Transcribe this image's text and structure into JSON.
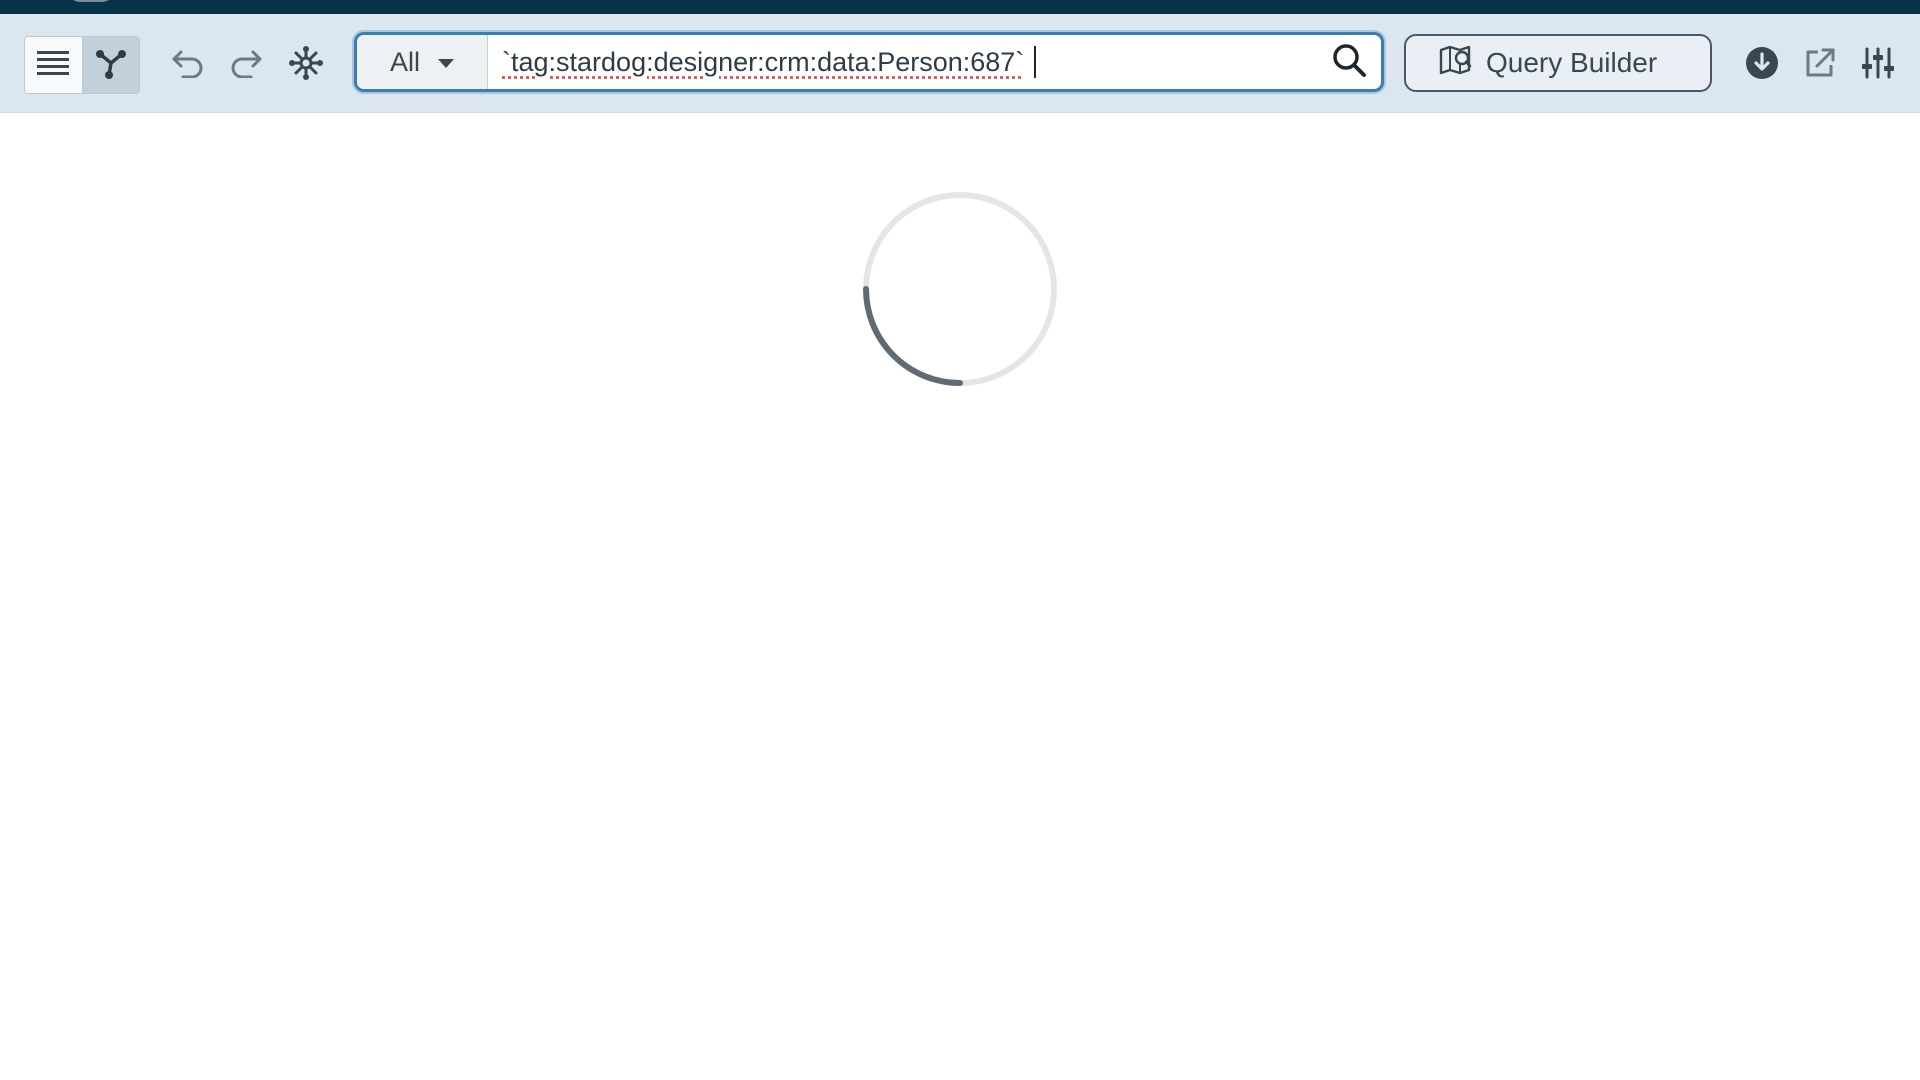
{
  "toolbar": {
    "view_toggle": {
      "list_icon": "list-icon",
      "graph_icon": "graph-icon",
      "active": "graph"
    },
    "actions": [
      "undo-icon",
      "redo-icon",
      "layout-icon"
    ],
    "search": {
      "scope_value": "All",
      "query_text": "`tag:stardog:designer:crm:data:Person:687`",
      "search_icon": "search-icon"
    },
    "query_builder_label": "Query Builder",
    "right_icons": [
      "download-icon",
      "open-external-icon",
      "settings-sliders-icon"
    ]
  },
  "main": {
    "state": "loading",
    "spinner_icon": "loading-spinner"
  },
  "colors": {
    "top_strip": "#06324a",
    "toolbar_bg": "#dbe6ef",
    "focus_border": "#3b7eb0",
    "icon": "#4a5a66"
  }
}
